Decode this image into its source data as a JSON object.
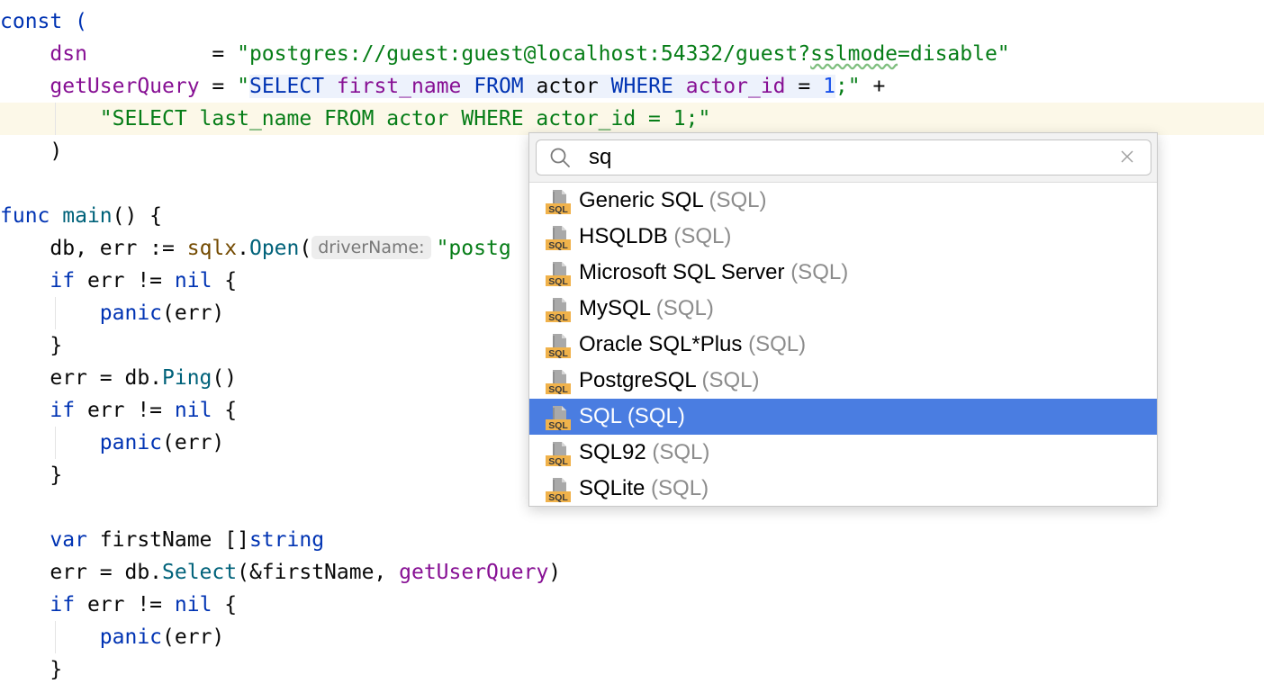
{
  "editor": {
    "lines": [
      {
        "t": "const ("
      },
      {
        "dsn_name": "dsn",
        "dsn_pad": "          = ",
        "dsn_value": "\"postgres://guest:guest@localhost:54332/guest?",
        "dsn_typo": "sslmode",
        "dsn_tail": "=disable\""
      },
      {
        "q_name": "getUserQuery",
        "q_eq": " = ",
        "q_open": "\"",
        "q_select": "SELECT",
        "q_col": "first_name",
        "q_from": "FROM",
        "q_tbl": "actor",
        "q_where": "WHERE",
        "q_id": "actor_id",
        "q_eq2": " = ",
        "q_num": "1",
        "q_close": ";\"",
        "q_plus": " +"
      },
      {
        "s2_open": "\"SELECT last_name FROM actor WHERE actor_id = 1;\""
      },
      {
        "t": ")"
      },
      {
        "func_kw": "func",
        "func_name": "main",
        "func_rest": "() {"
      },
      {
        "db_a": "db, err := ",
        "db_pkg": "sqlx",
        "db_dot": ".",
        "db_fn": "Open",
        "db_paren": "(",
        "db_hint": "driverName:",
        "db_str": "\"postg"
      },
      {
        "if": "if",
        "cond": " err != ",
        "nil": "nil",
        "brace": " {"
      },
      {
        "panic": "panic",
        "args": "(err)"
      },
      {
        "t": "}"
      },
      {
        "ping_a": "err = db.",
        "ping_fn": "Ping",
        "ping_b": "()"
      },
      {
        "if": "if",
        "cond": " err != ",
        "nil": "nil",
        "brace": " {"
      },
      {
        "panic": "panic",
        "args": "(err)"
      },
      {
        "t": "}"
      },
      {
        "var_kw": "var",
        "var_name": " firstName []",
        "var_type": "string"
      },
      {
        "sel_a": "err = db.",
        "sel_fn": "Select",
        "sel_b": "(&firstName, ",
        "sel_arg": "getUserQuery",
        "sel_c": ")"
      },
      {
        "if": "if",
        "cond": " err != ",
        "nil": "nil",
        "brace": " {"
      },
      {
        "panic": "panic",
        "args": "(err)"
      },
      {
        "t": "}"
      }
    ]
  },
  "popup": {
    "search": {
      "value": "sq",
      "search_icon": "magnifier-icon",
      "clear_icon": "close-icon"
    },
    "file_icon": "sql-file-icon",
    "items": [
      {
        "name": "Generic SQL",
        "type": "(SQL)"
      },
      {
        "name": "HSQLDB",
        "type": "(SQL)"
      },
      {
        "name": "Microsoft SQL Server",
        "type": "(SQL)"
      },
      {
        "name": "MySQL",
        "type": "(SQL)"
      },
      {
        "name": "Oracle SQL*Plus",
        "type": "(SQL)"
      },
      {
        "name": "PostgreSQL",
        "type": "(SQL)"
      },
      {
        "name": "SQL",
        "type": "(SQL)",
        "selected": true
      },
      {
        "name": "SQL92",
        "type": "(SQL)"
      },
      {
        "name": "SQLite",
        "type": "(SQL)"
      }
    ],
    "icon_badge": "SQL"
  },
  "colors": {
    "selection": "#4a7de1",
    "keyword": "#0033b3",
    "string": "#067d17",
    "caret_row": "#fcf8e8"
  }
}
